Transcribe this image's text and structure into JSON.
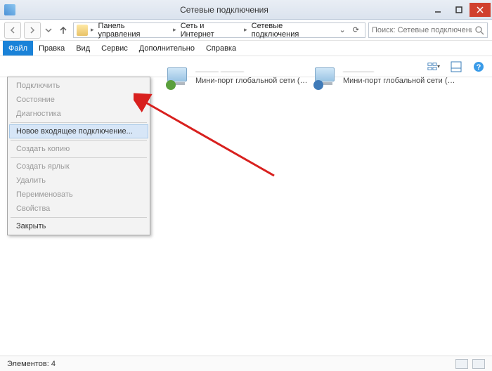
{
  "title": "Сетевые подключения",
  "breadcrumb": {
    "items": [
      "Панель управления",
      "Сеть и Интернет",
      "Сетевые подключения"
    ]
  },
  "search": {
    "placeholder": "Поиск: Сетевые подключения"
  },
  "menubar": {
    "items": [
      "Файл",
      "Правка",
      "Вид",
      "Сервис",
      "Дополнительно",
      "Справка"
    ],
    "active_index": 0
  },
  "dropdown": {
    "groups": [
      [
        {
          "label": "Подключить",
          "enabled": false
        },
        {
          "label": "Состояние",
          "enabled": false
        },
        {
          "label": "Диагностика",
          "enabled": false
        }
      ],
      [
        {
          "label": "Новое входящее подключение...",
          "enabled": true,
          "highlight": true
        }
      ],
      [
        {
          "label": "Создать копию",
          "enabled": false
        }
      ],
      [
        {
          "label": "Создать ярлык",
          "enabled": false
        },
        {
          "label": "Удалить",
          "enabled": false
        },
        {
          "label": "Переименовать",
          "enabled": false
        },
        {
          "label": "Свойства",
          "enabled": false
        }
      ],
      [
        {
          "label": "Закрыть",
          "enabled": true
        }
      ]
    ]
  },
  "connections": [
    {
      "name": "——— ———",
      "sub": "Мини-порт глобальной сети (P...",
      "badge_color": "#5a9f3c"
    },
    {
      "name": "————",
      "sub": "Мини-порт глобальной сети (P...",
      "badge_color": "#3f7ab8"
    }
  ],
  "statusbar": {
    "text": "Элементов: 4"
  }
}
